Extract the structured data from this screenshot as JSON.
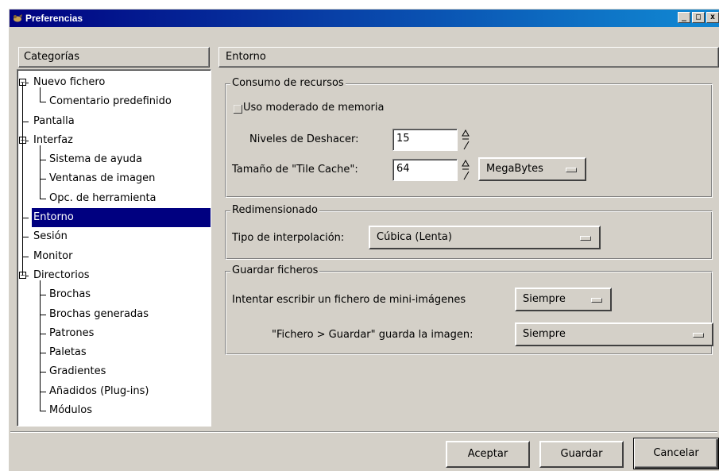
{
  "window": {
    "title": "Preferencias",
    "controls": [
      "_",
      "□",
      "x"
    ]
  },
  "categories": {
    "header": "Categorías",
    "items": [
      {
        "label": "Nuevo fichero",
        "level": 0,
        "expander": "−"
      },
      {
        "label": "Comentario predefinido",
        "level": 1,
        "last": true
      },
      {
        "label": "Pantalla",
        "level": 0
      },
      {
        "label": "Interfaz",
        "level": 0,
        "expander": "−"
      },
      {
        "label": "Sistema de ayuda",
        "level": 1
      },
      {
        "label": "Ventanas de imagen",
        "level": 1
      },
      {
        "label": "Opc. de herramienta",
        "level": 1,
        "last": true
      },
      {
        "label": "Entorno",
        "level": 0,
        "selected": true
      },
      {
        "label": "Sesión",
        "level": 0
      },
      {
        "label": "Monitor",
        "level": 0
      },
      {
        "label": "Directorios",
        "level": 0,
        "expander": "−"
      },
      {
        "label": "Brochas",
        "level": 1
      },
      {
        "label": "Brochas generadas",
        "level": 1
      },
      {
        "label": "Patrones",
        "level": 1
      },
      {
        "label": "Paletas",
        "level": 1
      },
      {
        "label": "Gradientes",
        "level": 1
      },
      {
        "label": "Añadidos (Plug-ins)",
        "level": 1
      },
      {
        "label": "Módulos",
        "level": 1,
        "last": true
      }
    ]
  },
  "section_title": "Entorno",
  "resources": {
    "title": "Consumo de recursos",
    "checkbox_label": "Uso moderado de memoria",
    "checked": false,
    "undo_label": "Niveles de Deshacer:",
    "undo_value": "15",
    "tile_label": "Tamaño de \"Tile Cache\":",
    "tile_value": "64",
    "tile_unit": "MegaBytes"
  },
  "resize": {
    "title": "Redimensionado",
    "interp_label": "Tipo de interpolación:",
    "interp_value": "Cúbica (Lenta)"
  },
  "save": {
    "title": "Guardar ficheros",
    "thumb_label": "Intentar escribir un fichero de mini-imágenes",
    "thumb_value": "Siempre",
    "save_label": "\"Fichero > Guardar\" guarda la imagen:",
    "save_value": "Siempre"
  },
  "buttons": {
    "ok": "Aceptar",
    "save": "Guardar",
    "cancel": "Cancelar"
  },
  "colors": {
    "face": "#d4d0c8",
    "title_bar": "#000080",
    "selection": "#000080"
  }
}
